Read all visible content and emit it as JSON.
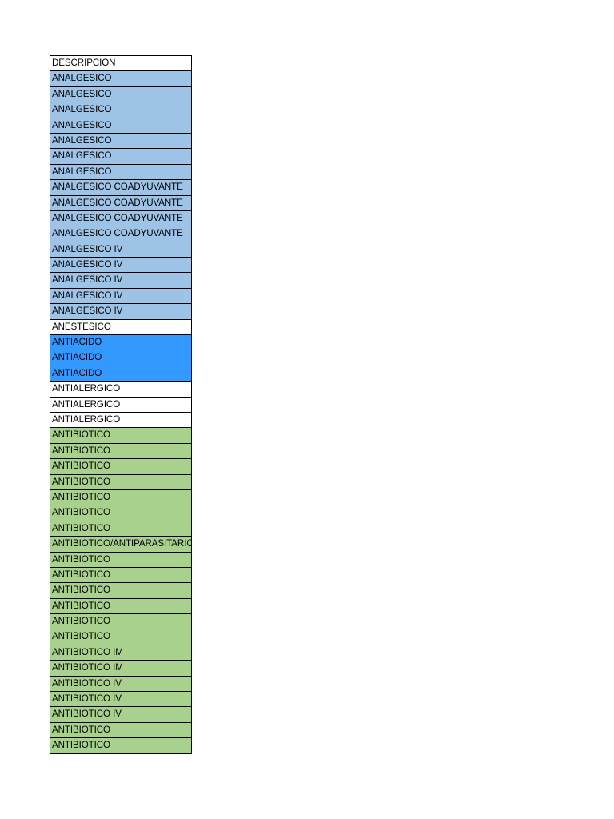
{
  "sheet": {
    "colors": {
      "white": "#ffffff",
      "light_blue": "#9dc3e6",
      "blue": "#3399ff",
      "green": "#a9d18e"
    },
    "cells": [
      {
        "text": "DESCRIPCION",
        "fill": "white"
      },
      {
        "text": "ANALGESICO",
        "fill": "light_blue"
      },
      {
        "text": "ANALGESICO",
        "fill": "light_blue"
      },
      {
        "text": "ANALGESICO",
        "fill": "light_blue"
      },
      {
        "text": "ANALGESICO",
        "fill": "light_blue"
      },
      {
        "text": "ANALGESICO",
        "fill": "light_blue"
      },
      {
        "text": "ANALGESICO",
        "fill": "light_blue"
      },
      {
        "text": "ANALGESICO",
        "fill": "light_blue"
      },
      {
        "text": "ANALGESICO COADYUVANTE",
        "fill": "light_blue"
      },
      {
        "text": "ANALGESICO COADYUVANTE",
        "fill": "light_blue"
      },
      {
        "text": "ANALGESICO COADYUVANTE",
        "fill": "light_blue"
      },
      {
        "text": "ANALGESICO COADYUVANTE",
        "fill": "light_blue"
      },
      {
        "text": "ANALGESICO IV",
        "fill": "light_blue"
      },
      {
        "text": "ANALGESICO IV",
        "fill": "light_blue"
      },
      {
        "text": "ANALGESICO IV",
        "fill": "light_blue"
      },
      {
        "text": "ANALGESICO IV",
        "fill": "light_blue"
      },
      {
        "text": "ANALGESICO IV",
        "fill": "light_blue"
      },
      {
        "text": "ANESTESICO",
        "fill": "white"
      },
      {
        "text": "ANTIACIDO",
        "fill": "blue"
      },
      {
        "text": "ANTIACIDO",
        "fill": "blue"
      },
      {
        "text": "ANTIACIDO",
        "fill": "blue"
      },
      {
        "text": "ANTIALERGICO",
        "fill": "white"
      },
      {
        "text": "ANTIALERGICO",
        "fill": "white"
      },
      {
        "text": "ANTIALERGICO",
        "fill": "white"
      },
      {
        "text": "ANTIBIOTICO",
        "fill": "green"
      },
      {
        "text": "ANTIBIOTICO",
        "fill": "green"
      },
      {
        "text": "ANTIBIOTICO",
        "fill": "green"
      },
      {
        "text": "ANTIBIOTICO",
        "fill": "green"
      },
      {
        "text": "ANTIBIOTICO",
        "fill": "green"
      },
      {
        "text": "ANTIBIOTICO",
        "fill": "green"
      },
      {
        "text": "ANTIBIOTICO",
        "fill": "green"
      },
      {
        "text": "ANTIBIOTICO/ANTIPARASITARIO",
        "fill": "green"
      },
      {
        "text": "ANTIBIOTICO",
        "fill": "green"
      },
      {
        "text": "ANTIBIOTICO",
        "fill": "green"
      },
      {
        "text": "ANTIBIOTICO",
        "fill": "green"
      },
      {
        "text": "ANTIBIOTICO",
        "fill": "green"
      },
      {
        "text": "ANTIBIOTICO",
        "fill": "green"
      },
      {
        "text": "ANTIBIOTICO",
        "fill": "green"
      },
      {
        "text": "ANTIBIOTICO IM",
        "fill": "green"
      },
      {
        "text": "ANTIBIOTICO IM",
        "fill": "green"
      },
      {
        "text": "ANTIBIOTICO IV",
        "fill": "green"
      },
      {
        "text": "ANTIBIOTICO IV",
        "fill": "green"
      },
      {
        "text": "ANTIBIOTICO IV",
        "fill": "green"
      },
      {
        "text": "ANTIBIOTICO",
        "fill": "green"
      },
      {
        "text": "ANTIBIOTICO",
        "fill": "green"
      }
    ]
  }
}
